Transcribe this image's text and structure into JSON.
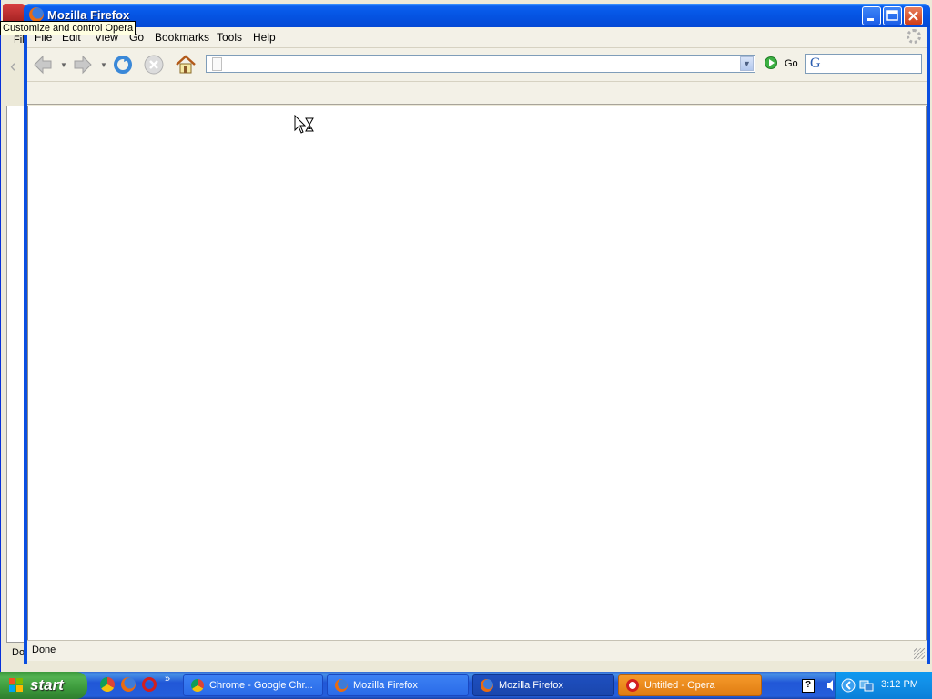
{
  "background_window": {
    "menu_fragment": "Fil",
    "status_fragment": "Do"
  },
  "tooltip": "Customize and control Opera",
  "window": {
    "title": "Mozilla Firefox",
    "minimize": "_",
    "maximize": "□",
    "close": "✕"
  },
  "menu": {
    "file": "File",
    "edit": "Edit",
    "view": "View",
    "go": "Go",
    "bookmarks": "Bookmarks",
    "tools": "Tools",
    "help": "Help"
  },
  "toolbar": {
    "go_label": "Go",
    "url_value": "",
    "search_value": ""
  },
  "status": {
    "text": "Done"
  },
  "taskbar": {
    "start_label": "start",
    "more": "»",
    "buttons": [
      {
        "label": "Chrome - Google Chr..."
      },
      {
        "label": "Mozilla Firefox"
      },
      {
        "label": "Mozilla Firefox"
      },
      {
        "label": "Untitled - Opera"
      }
    ],
    "clock": "3:12 PM"
  },
  "icons": [
    "firefox-icon",
    "back-arrow-icon",
    "forward-arrow-icon",
    "reload-icon",
    "stop-icon",
    "home-icon",
    "page-icon",
    "go-arrow-icon",
    "google-icon",
    "throbber-icon",
    "hourglass-cursor-icon",
    "windows-flag-icon",
    "chrome-icon",
    "opera-icon",
    "help-icon"
  ],
  "colors": {
    "titlebar": "#0554e3",
    "chrome_bg": "#ece9d8",
    "taskbar": "#245edb",
    "start": "#3c9a3c",
    "opera_task": "#e07c12"
  }
}
